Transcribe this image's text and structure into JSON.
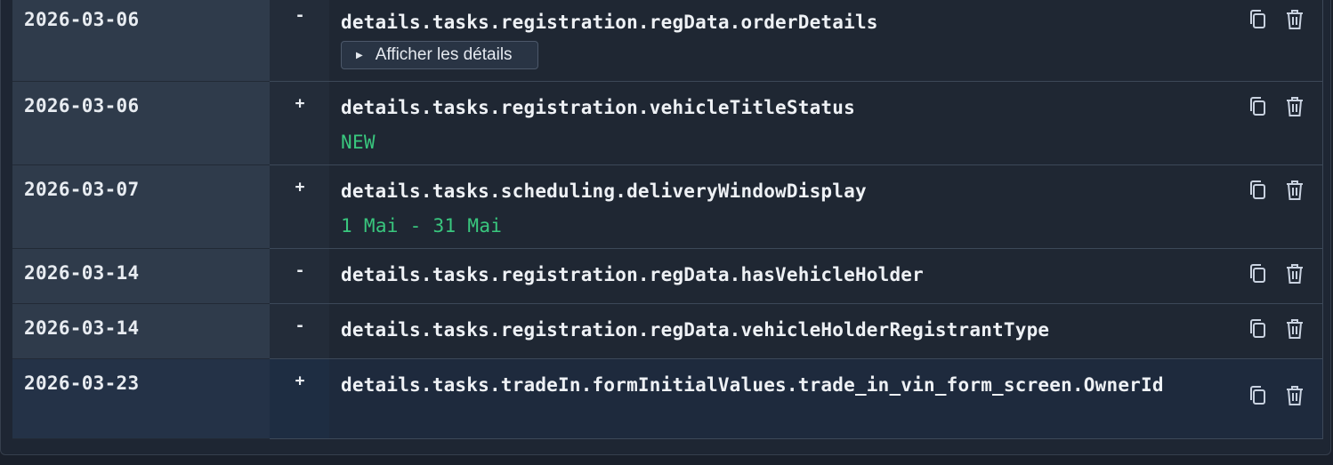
{
  "rows": [
    {
      "date": "2026-03-06",
      "sign": "-",
      "key": "details.tasks.registration.regData.orderDetails",
      "details_label": "Afficher les détails",
      "copy_icon": "copy-icon",
      "trash_icon": "trash-icon"
    },
    {
      "date": "2026-03-06",
      "sign": "+",
      "key": "details.tasks.registration.vehicleTitleStatus",
      "value": "NEW",
      "copy_icon": "copy-icon",
      "trash_icon": "trash-icon"
    },
    {
      "date": "2026-03-07",
      "sign": "+",
      "key": "details.tasks.scheduling.deliveryWindowDisplay",
      "value": "1 Mai - 31 Mai",
      "copy_icon": "copy-icon",
      "trash_icon": "trash-icon"
    },
    {
      "date": "2026-03-14",
      "sign": "-",
      "key": "details.tasks.registration.regData.hasVehicleHolder",
      "copy_icon": "copy-icon",
      "trash_icon": "trash-icon"
    },
    {
      "date": "2026-03-14",
      "sign": "-",
      "key": "details.tasks.registration.regData.vehicleHolderRegistrantType",
      "copy_icon": "copy-icon",
      "trash_icon": "trash-icon"
    },
    {
      "date": "2026-03-23",
      "sign": "+",
      "key": "details.tasks.tradeIn.formInitialValues.trade_in_vin_form_screen.OwnerId",
      "copy_icon": "copy-icon",
      "trash_icon": "trash-icon"
    }
  ],
  "colors": {
    "value_green": "#39c77e",
    "text": "#eef1f5",
    "date_cell": "#2f3b4b",
    "highlight_row": "#1e2a3d"
  }
}
